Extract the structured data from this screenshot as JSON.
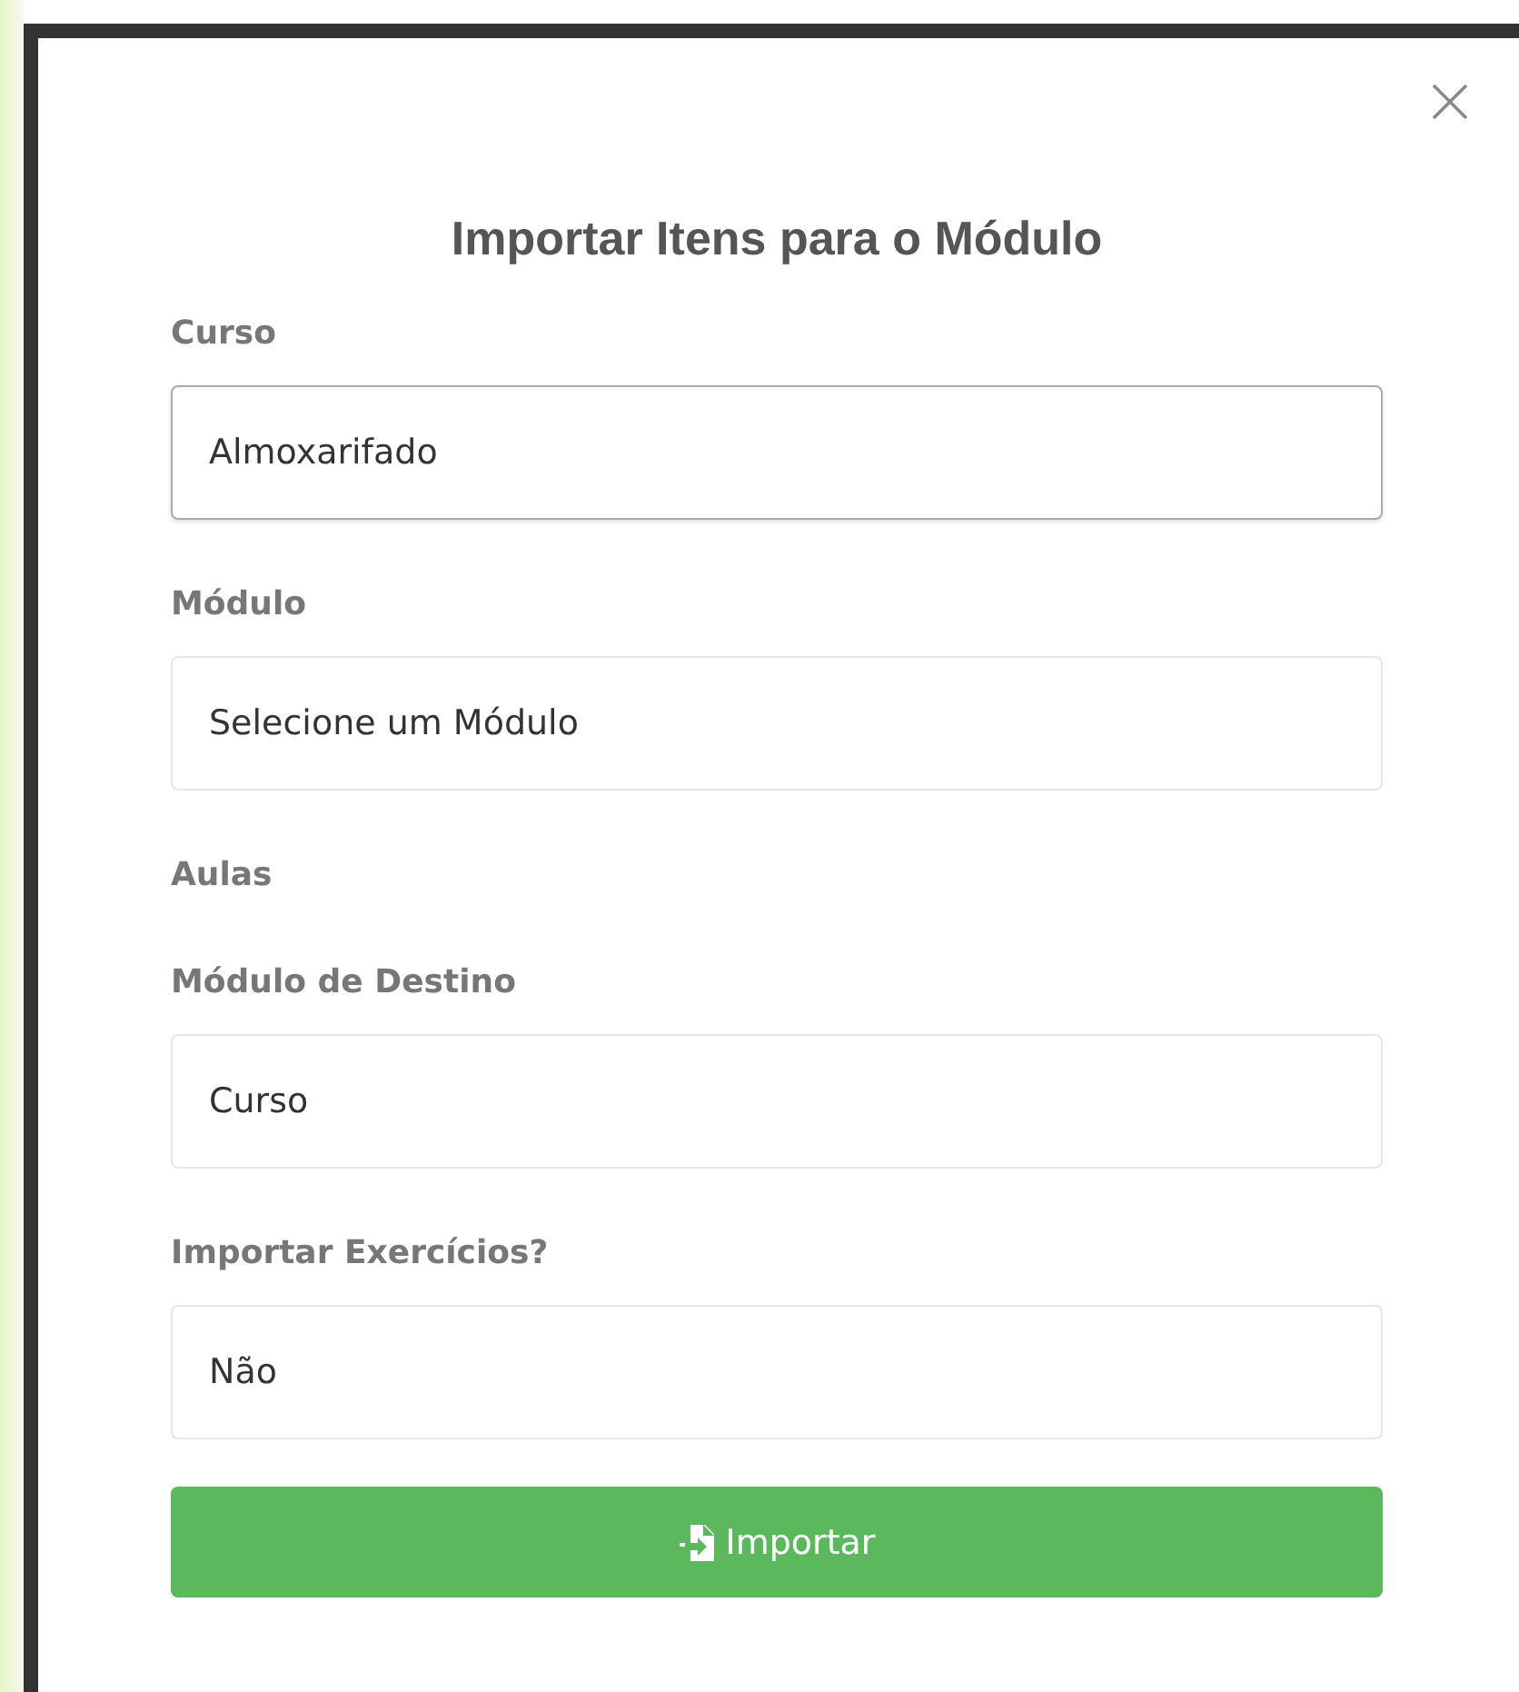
{
  "dialog": {
    "title": "Importar Itens para o Módulo",
    "fields": [
      {
        "label": "Curso",
        "value": "Almoxarifado",
        "focused": true
      },
      {
        "label": "Módulo",
        "value": "Selecione um Módulo",
        "focused": false
      },
      {
        "label": "Aulas"
      },
      {
        "label": "Módulo de Destino",
        "value": "Curso",
        "focused": false
      },
      {
        "label": "Importar Exercícios?",
        "value": "Não",
        "focused": false
      }
    ],
    "button": {
      "label": "Importar"
    }
  }
}
